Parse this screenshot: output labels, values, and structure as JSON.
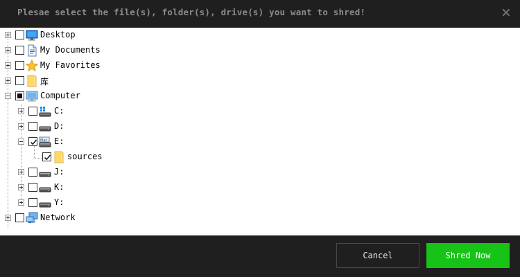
{
  "dialog": {
    "title": "Plesae select the file(s), folder(s), drive(s) you want to shred!",
    "close_icon": "close-icon"
  },
  "tree": {
    "items": [
      {
        "label": "Desktop",
        "icon": "desktop-icon",
        "expander": "plus",
        "checked": false
      },
      {
        "label": "My Documents",
        "icon": "document-icon",
        "expander": "plus",
        "checked": false
      },
      {
        "label": "My Favorites",
        "icon": "star-icon",
        "expander": "plus",
        "checked": false
      },
      {
        "label": "库",
        "icon": "folder-icon",
        "expander": "plus",
        "checked": false
      },
      {
        "label": "Computer",
        "icon": "computer-icon",
        "expander": "minus",
        "checked": "partial",
        "children": [
          {
            "label": "C:",
            "icon": "windows-drive-icon",
            "expander": "plus",
            "checked": false
          },
          {
            "label": "D:",
            "icon": "drive-icon",
            "expander": "plus",
            "checked": false
          },
          {
            "label": "E:",
            "icon": "mac-drive-icon",
            "expander": "minus",
            "checked": true,
            "children": [
              {
                "label": "sources",
                "icon": "folder-icon",
                "checked": true
              }
            ]
          },
          {
            "label": "J:",
            "icon": "drive-icon",
            "expander": "plus",
            "checked": false
          },
          {
            "label": "K:",
            "icon": "drive-icon",
            "expander": "plus",
            "checked": false
          },
          {
            "label": "Y:",
            "icon": "drive-icon",
            "expander": "plus",
            "checked": false
          }
        ]
      },
      {
        "label": "Network",
        "icon": "network-icon",
        "expander": "plus",
        "checked": false
      }
    ]
  },
  "footer": {
    "cancel_label": "Cancel",
    "shred_label": "Shred Now"
  },
  "colors": {
    "background": "#1f1f1f",
    "title_text": "#8c8c8c",
    "accent_green": "#16c316",
    "tree_background": "#ffffff"
  }
}
